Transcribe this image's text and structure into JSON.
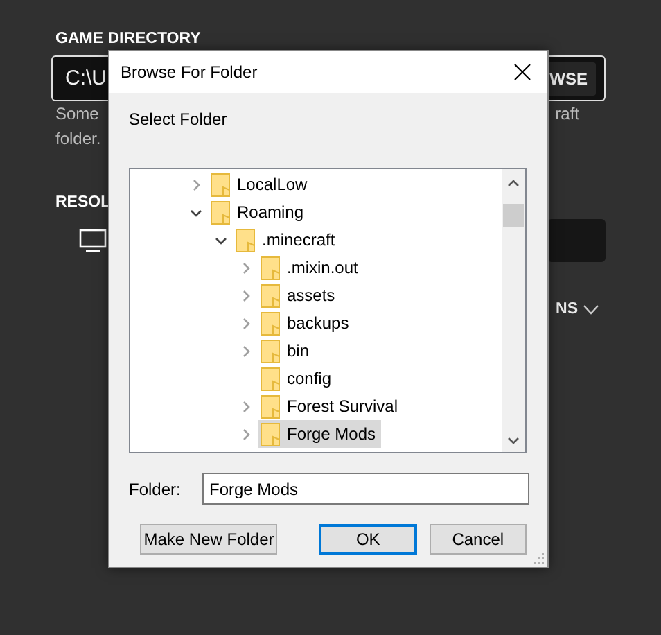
{
  "background": {
    "heading": "GAME DIRECTORY",
    "path_value": "C:\\U",
    "browse_button": "WSE",
    "note_lines": [
      {
        "left": "Some",
        "right": "raft"
      },
      {
        "left": "folder."
      }
    ],
    "resolution_heading": "RESOL",
    "options_toggle": "NS"
  },
  "dialog": {
    "title": "Browse For Folder",
    "prompt": "Select Folder",
    "tree": [
      {
        "label": "LocalLow",
        "expanded": false,
        "selected": false
      },
      {
        "label": "Roaming",
        "expanded": true,
        "selected": false,
        "children": [
          {
            "label": ".minecraft",
            "expanded": true,
            "selected": false,
            "children": [
              {
                "label": ".mixin.out",
                "expanded": false,
                "selected": false
              },
              {
                "label": "assets",
                "expanded": false,
                "selected": false
              },
              {
                "label": "backups",
                "expanded": false,
                "selected": false
              },
              {
                "label": "bin",
                "expanded": false,
                "selected": false
              },
              {
                "label": "config",
                "selected": false
              },
              {
                "label": "Forest Survival",
                "expanded": false,
                "selected": false
              },
              {
                "label": "Forge Mods",
                "expanded": false,
                "selected": true
              }
            ]
          }
        ]
      }
    ],
    "folder_label": "Folder:",
    "folder_value": "Forge Mods",
    "buttons": [
      {
        "label": "Make New Folder",
        "default": false
      },
      {
        "label": "OK",
        "default": true
      },
      {
        "label": "Cancel",
        "default": false
      }
    ]
  }
}
